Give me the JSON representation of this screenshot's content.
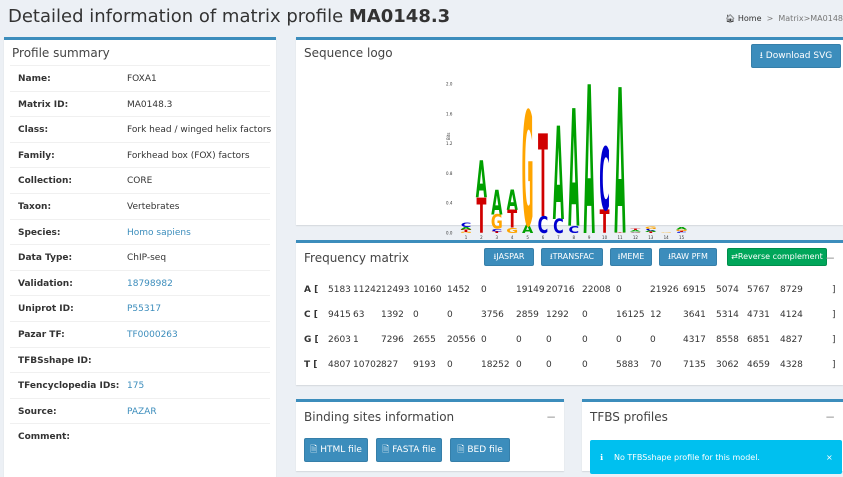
{
  "header": {
    "title_prefix": "Detailed information of matrix profile ",
    "title_id": "MA0148.3"
  },
  "breadcrumb": {
    "home": "Home",
    "sep": ">",
    "matrix": "Matrix",
    "current": "MA0148"
  },
  "summary": {
    "title": "Profile summary",
    "rows": [
      {
        "key": "Name:",
        "value": "FOXA1",
        "link": false
      },
      {
        "key": "Matrix ID:",
        "value": "MA0148.3",
        "link": false
      },
      {
        "key": "Class:",
        "value": "Fork head / winged helix factors",
        "link": false
      },
      {
        "key": "Family:",
        "value": "Forkhead box (FOX) factors",
        "link": false
      },
      {
        "key": "Collection:",
        "value": "CORE",
        "link": false
      },
      {
        "key": "Taxon:",
        "value": "Vertebrates",
        "link": false
      },
      {
        "key": "Species:",
        "value": "Homo sapiens",
        "link": true
      },
      {
        "key": "Data Type:",
        "value": "ChIP-seq",
        "link": false
      },
      {
        "key": "Validation:",
        "value": "18798982",
        "link": true
      },
      {
        "key": "Uniprot ID:",
        "value": "P55317",
        "link": true
      },
      {
        "key": "Pazar TF:",
        "value": "TF0000263",
        "link": true
      },
      {
        "key": "TFBSshape ID:",
        "value": "",
        "link": false
      },
      {
        "key": "TFencyclopedia IDs:",
        "value": "175",
        "link": true
      },
      {
        "key": "Source:",
        "value": "PAZAR",
        "link": true
      },
      {
        "key": "Comment:",
        "value": "",
        "link": false
      }
    ]
  },
  "sequence_logo": {
    "title": "Sequence logo",
    "download_label": "Download SVG",
    "y_ticks": [
      "2.0",
      "1.6",
      "1.2",
      "0.8",
      "0.4",
      "0.0"
    ],
    "y_label": "Bits",
    "x_ticks": [
      "1",
      "2",
      "3",
      "4",
      "5",
      "6",
      "7",
      "8",
      "9",
      "10",
      "11",
      "12",
      "13",
      "14",
      "15"
    ]
  },
  "frequency_matrix": {
    "title": "Frequency matrix",
    "buttons": [
      "JASPAR",
      "TRANSFAC",
      "MEME",
      "RAW PFM"
    ],
    "reverse_label": "Reverse complement",
    "rows": [
      {
        "base": "A [",
        "values": [
          "5183",
          "11242",
          "12493",
          "10160",
          "1452",
          "0",
          "19149",
          "20716",
          "22008",
          "0",
          "21926",
          "6915",
          "5074",
          "5767",
          "8729"
        ],
        "close": "]"
      },
      {
        "base": "C [",
        "values": [
          "9415",
          "63",
          "1392",
          "0",
          "0",
          "3756",
          "2859",
          "1292",
          "0",
          "16125",
          "12",
          "3641",
          "5314",
          "4731",
          "4124"
        ],
        "close": "]"
      },
      {
        "base": "G [",
        "values": [
          "2603",
          "1",
          "7296",
          "2655",
          "20556",
          "0",
          "0",
          "0",
          "0",
          "0",
          "0",
          "4317",
          "8558",
          "6851",
          "4827"
        ],
        "close": "]"
      },
      {
        "base": "T [",
        "values": [
          "4807",
          "10702",
          "827",
          "9193",
          "0",
          "18252",
          "0",
          "0",
          "0",
          "5883",
          "70",
          "7135",
          "3062",
          "4659",
          "4328"
        ],
        "close": "]"
      }
    ]
  },
  "binding_sites": {
    "title": "Binding sites information",
    "buttons": [
      "HTML file",
      "FASTA file",
      "BED file"
    ]
  },
  "tfbs_profiles": {
    "title": "TFBS profiles",
    "alert": "No TFBSshape profile for this model."
  },
  "colors": {
    "A": "#00a000",
    "C": "#0000d0",
    "G": "#ffa500",
    "T": "#d00000",
    "accent": "#3c8dbc"
  }
}
